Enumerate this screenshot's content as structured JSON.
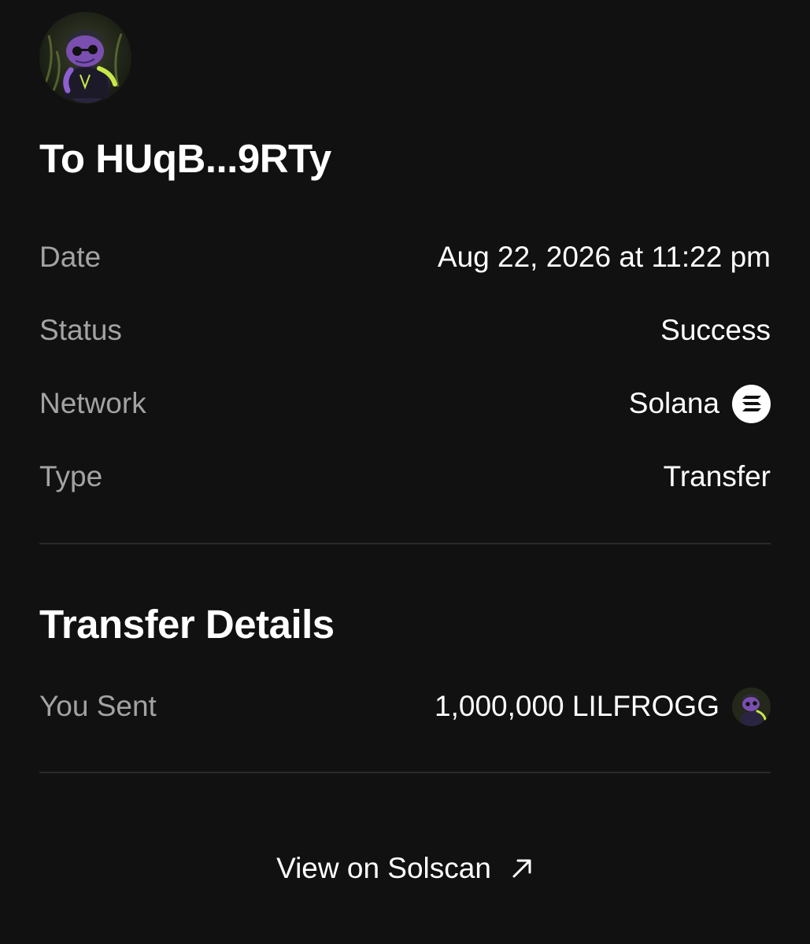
{
  "header": {
    "title": "To HUqB...9RTy",
    "avatar_icon": "frog-avatar-icon"
  },
  "summary": {
    "rows": [
      {
        "label": "Date",
        "value": "Aug 22, 2026 at 11:22 pm"
      },
      {
        "label": "Status",
        "value": "Success"
      },
      {
        "label": "Network",
        "value": "Solana",
        "icon": "solana-icon"
      },
      {
        "label": "Type",
        "value": "Transfer"
      }
    ]
  },
  "transfer_details": {
    "title": "Transfer Details",
    "rows": [
      {
        "label": "You Sent",
        "value": "1,000,000 LILFROGG",
        "icon": "lilfrogg-token-icon"
      }
    ]
  },
  "footer": {
    "link_label": "View on Solscan",
    "link_icon": "external-arrow-icon"
  },
  "colors": {
    "background": "#111111",
    "label": "#a3a3a3",
    "value": "#ffffff",
    "divider": "#2a2a2a"
  }
}
